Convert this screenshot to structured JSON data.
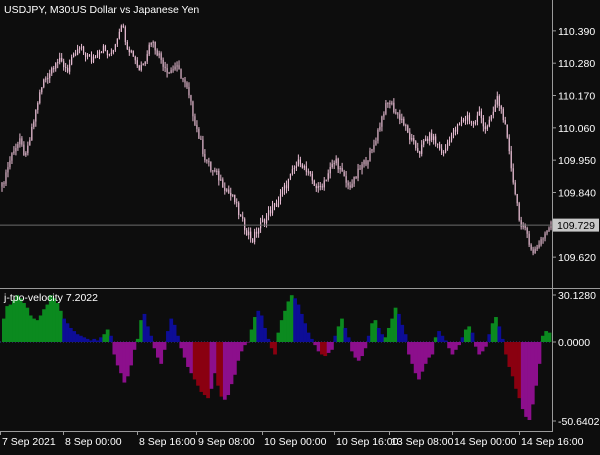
{
  "header": {
    "symbol_label": "USDJPY, M30:",
    "description": "US Dollar vs Japanese Yen"
  },
  "indicator": {
    "label": "j-tpo-velocity 7.2022"
  },
  "current_price_label": "109.729",
  "colors": {
    "background": "#0d0d0d",
    "grid_line": "#555555",
    "text": "#ffffff",
    "candle": "#e6bcd2",
    "current_price_line": "#6b6b6b",
    "current_price_box": "#c8c8c8",
    "hist_green": "#0b8a1f",
    "hist_blue": "#0d0d96",
    "hist_red": "#8a0010",
    "hist_magenta": "#8c0f8c"
  },
  "chart_data": [
    {
      "type": "candlestick",
      "title": "USDJPY, M30: US Dollar vs Japanese Yen",
      "ylim": [
        109.515,
        110.495
      ],
      "y_ticks": [
        "110.390",
        "110.280",
        "110.170",
        "110.060",
        "109.950",
        "109.840",
        "109.620"
      ],
      "current_price": 109.729,
      "x_ticks": [
        "7 Sep 2021",
        "8 Sep 00:00",
        "8 Sep 16:00",
        "9 Sep 08:00",
        "10 Sep 00:00",
        "10 Sep 16:00",
        "13 Sep 08:00",
        "14 Sep 00:00",
        "14 Sep 16:00"
      ],
      "close_path": [
        [
          0,
          109.86
        ],
        [
          3,
          109.93
        ],
        [
          6,
          109.99
        ],
        [
          9,
          110.01
        ],
        [
          12,
          109.96
        ],
        [
          15,
          110.05
        ],
        [
          18,
          110.15
        ],
        [
          21,
          110.22
        ],
        [
          24,
          110.25
        ],
        [
          27,
          110.29
        ],
        [
          30,
          110.28
        ],
        [
          33,
          110.26
        ],
        [
          36,
          110.3
        ],
        [
          39,
          110.33
        ],
        [
          42,
          110.31
        ],
        [
          45,
          110.29
        ],
        [
          48,
          110.32
        ],
        [
          51,
          110.33
        ],
        [
          54,
          110.3
        ],
        [
          57,
          110.35
        ],
        [
          60,
          110.42
        ],
        [
          63,
          110.34
        ],
        [
          66,
          110.31
        ],
        [
          69,
          110.26
        ],
        [
          72,
          110.3
        ],
        [
          75,
          110.36
        ],
        [
          78,
          110.32
        ],
        [
          81,
          110.28
        ],
        [
          84,
          110.25
        ],
        [
          87,
          110.27
        ],
        [
          90,
          110.24
        ],
        [
          93,
          110.19
        ],
        [
          96,
          110.11
        ],
        [
          99,
          110.03
        ],
        [
          102,
          109.96
        ],
        [
          105,
          109.92
        ],
        [
          108,
          109.9
        ],
        [
          111,
          109.87
        ],
        [
          114,
          109.84
        ],
        [
          117,
          109.81
        ],
        [
          120,
          109.75
        ],
        [
          123,
          109.71
        ],
        [
          126,
          109.68
        ],
        [
          129,
          109.72
        ],
        [
          132,
          109.75
        ],
        [
          135,
          109.78
        ],
        [
          138,
          109.8
        ],
        [
          141,
          109.84
        ],
        [
          144,
          109.88
        ],
        [
          147,
          109.92
        ],
        [
          150,
          109.95
        ],
        [
          153,
          109.91
        ],
        [
          156,
          109.88
        ],
        [
          159,
          109.85
        ],
        [
          162,
          109.88
        ],
        [
          165,
          109.92
        ],
        [
          168,
          109.95
        ],
        [
          171,
          109.9
        ],
        [
          174,
          109.86
        ],
        [
          177,
          109.88
        ],
        [
          180,
          109.92
        ],
        [
          183,
          109.95
        ],
        [
          186,
          109.98
        ],
        [
          189,
          110.05
        ],
        [
          192,
          110.12
        ],
        [
          195,
          110.15
        ],
        [
          198,
          110.11
        ],
        [
          201,
          110.09
        ],
        [
          204,
          110.04
        ],
        [
          207,
          110.0
        ],
        [
          210,
          109.98
        ],
        [
          213,
          110.02
        ],
        [
          216,
          110.03
        ],
        [
          219,
          110.0
        ],
        [
          222,
          109.97
        ],
        [
          225,
          110.03
        ],
        [
          228,
          110.05
        ],
        [
          231,
          110.08
        ],
        [
          234,
          110.1
        ],
        [
          237,
          110.07
        ],
        [
          240,
          110.11
        ],
        [
          243,
          110.06
        ],
        [
          246,
          110.09
        ],
        [
          249,
          110.16
        ],
        [
          252,
          110.1
        ],
        [
          255,
          109.97
        ],
        [
          258,
          109.84
        ],
        [
          261,
          109.72
        ],
        [
          264,
          109.7
        ],
        [
          267,
          109.63
        ],
        [
          270,
          109.67
        ],
        [
          273,
          109.7
        ],
        [
          276,
          109.73
        ]
      ]
    },
    {
      "type": "bar",
      "title": "j-tpo-velocity 7.2022",
      "ylim": [
        -50.6402,
        30.128
      ],
      "y_ticks": [
        "30.1280",
        "0.0000",
        "-50.6402"
      ],
      "series": [
        {
          "values": [
            15,
            23,
            24,
            27,
            30,
            28,
            25,
            22,
            17,
            15,
            14,
            17,
            21,
            24,
            30,
            28,
            25,
            20,
            15,
            12,
            9,
            7,
            5,
            4,
            3,
            2,
            1,
            2,
            1,
            3,
            5,
            8,
            4,
            -8,
            -15,
            -20,
            -26,
            -22,
            -15,
            -5,
            2,
            14,
            18,
            10,
            4,
            -4,
            -10,
            -14,
            -5,
            7,
            15,
            11,
            4,
            -4,
            -10,
            -16,
            -20,
            -24,
            -28,
            -32,
            -34,
            -36,
            -30,
            -20,
            -28,
            -35,
            -37,
            -34,
            -27,
            -21,
            -12,
            -6,
            -2,
            0,
            8,
            16,
            20,
            17,
            9,
            2,
            -4,
            -8,
            6,
            14,
            20,
            26,
            30,
            28,
            24,
            18,
            12,
            6,
            2,
            -2,
            -6,
            -8,
            -9,
            -7,
            -5,
            4,
            10,
            15,
            9,
            3,
            -6,
            -10,
            -12,
            -9,
            -4,
            4,
            12,
            14,
            9,
            5,
            3,
            9,
            15,
            22,
            18,
            11,
            5,
            -8,
            -14,
            -20,
            -24,
            -19,
            -14,
            -10,
            -8,
            3,
            7,
            4,
            1,
            -4,
            -8,
            -5,
            -2,
            3,
            8,
            10,
            6,
            -3,
            -8,
            -6,
            -3,
            5,
            12,
            16,
            10,
            2,
            -8,
            -16,
            -22,
            -30,
            -36,
            -43,
            -48,
            -50,
            -40,
            -28,
            -14,
            4,
            7,
            6
          ],
          "colors": [
            "green",
            "green",
            "green",
            "green",
            "green",
            "green",
            "green",
            "green",
            "green",
            "green",
            "green",
            "green",
            "green",
            "green",
            "green",
            "green",
            "green",
            "green",
            "blue",
            "blue",
            "blue",
            "blue",
            "blue",
            "blue",
            "blue",
            "blue",
            "blue",
            "blue",
            "blue",
            "blue",
            "green",
            "green",
            "blue",
            "magenta",
            "magenta",
            "magenta",
            "magenta",
            "magenta",
            "magenta",
            "magenta",
            "green",
            "green",
            "blue",
            "blue",
            "blue",
            "magenta",
            "magenta",
            "magenta",
            "magenta",
            "blue",
            "blue",
            "blue",
            "blue",
            "magenta",
            "magenta",
            "magenta",
            "magenta",
            "red",
            "red",
            "red",
            "red",
            "red",
            "magenta",
            "magenta",
            "red",
            "red",
            "magenta",
            "magenta",
            "magenta",
            "magenta",
            "magenta",
            "magenta",
            "magenta",
            "magenta",
            "green",
            "green",
            "blue",
            "blue",
            "blue",
            "blue",
            "red",
            "red",
            "green",
            "green",
            "green",
            "green",
            "green",
            "blue",
            "blue",
            "blue",
            "blue",
            "blue",
            "blue",
            "magenta",
            "magenta",
            "red",
            "red",
            "magenta",
            "magenta",
            "blue",
            "green",
            "green",
            "blue",
            "blue",
            "magenta",
            "magenta",
            "magenta",
            "magenta",
            "magenta",
            "blue",
            "green",
            "green",
            "blue",
            "blue",
            "green",
            "green",
            "green",
            "green",
            "blue",
            "blue",
            "blue",
            "magenta",
            "magenta",
            "magenta",
            "magenta",
            "magenta",
            "magenta",
            "magenta",
            "magenta",
            "green",
            "blue",
            "blue",
            "blue",
            "magenta",
            "magenta",
            "magenta",
            "magenta",
            "blue",
            "green",
            "green",
            "blue",
            "magenta",
            "magenta",
            "magenta",
            "magenta",
            "blue",
            "green",
            "green",
            "blue",
            "blue",
            "red",
            "red",
            "red",
            "red",
            "red",
            "magenta",
            "magenta",
            "magenta",
            "magenta",
            "magenta",
            "magenta",
            "green",
            "green",
            "green"
          ]
        }
      ]
    }
  ]
}
